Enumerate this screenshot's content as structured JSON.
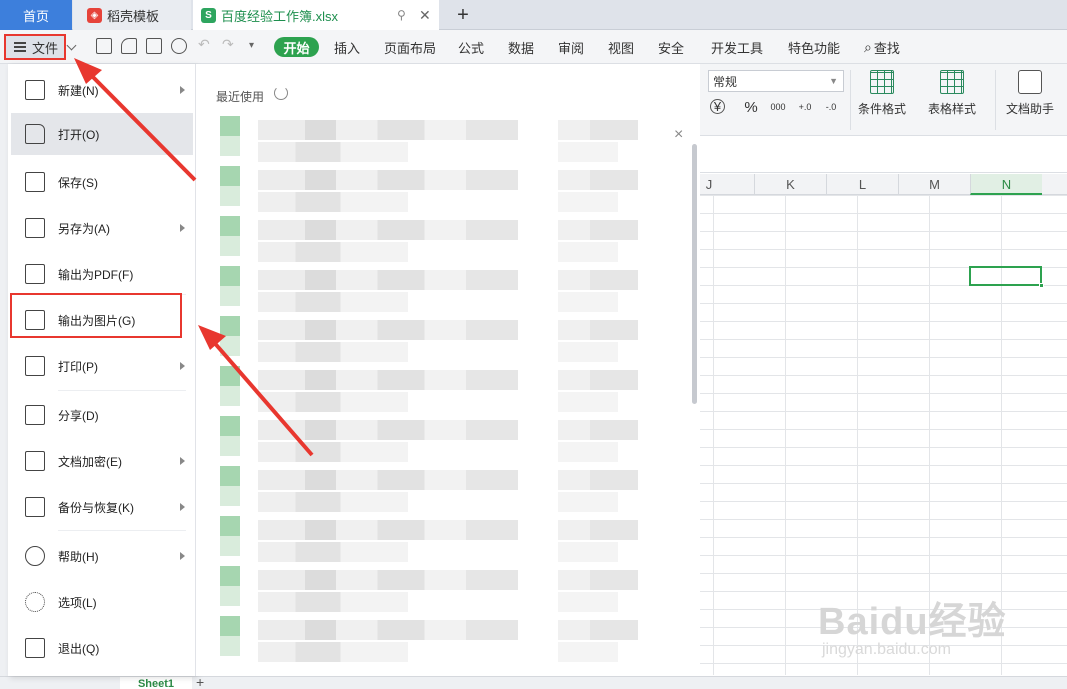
{
  "tabs": {
    "home": "首页",
    "templates": "稻壳模板",
    "workbook": "百度经验工作簿.xlsx",
    "new_tab": "+"
  },
  "menubar": {
    "file": "文件",
    "items": [
      "开始",
      "插入",
      "页面布局",
      "公式",
      "数据",
      "审阅",
      "视图",
      "安全",
      "开发工具",
      "特色功能",
      "查找"
    ]
  },
  "ribbon": {
    "number_format": "常规",
    "currency_symbol": "¥",
    "percent": "%",
    "thousands": "000",
    "inc_decimal": "+.0",
    "dec_decimal": "-.0",
    "conditional_format": "条件格式",
    "table_style": "表格样式",
    "doc_assistant": "文档助手"
  },
  "grid": {
    "columns": [
      "J",
      "K",
      "L",
      "M",
      "N"
    ],
    "active_column": "N"
  },
  "file_menu": {
    "items": [
      {
        "label": "新建(N)",
        "icon": "new-file-icon",
        "submenu": true
      },
      {
        "label": "打开(O)",
        "icon": "folder-open-icon",
        "submenu": false,
        "hover": true
      },
      {
        "label": "保存(S)",
        "icon": "save-icon",
        "submenu": false
      },
      {
        "label": "另存为(A)",
        "icon": "save-as-icon",
        "submenu": true
      },
      {
        "label": "输出为PDF(F)",
        "icon": "export-pdf-icon",
        "submenu": false
      },
      {
        "label": "输出为图片(G)",
        "icon": "export-image-icon",
        "submenu": false,
        "highlighted": true
      },
      {
        "label": "打印(P)",
        "icon": "print-icon",
        "submenu": true
      },
      {
        "label": "分享(D)",
        "icon": "share-icon",
        "submenu": false
      },
      {
        "label": "文档加密(E)",
        "icon": "encrypt-icon",
        "submenu": true
      },
      {
        "label": "备份与恢复(K)",
        "icon": "backup-icon",
        "submenu": true
      },
      {
        "label": "帮助(H)",
        "icon": "help-icon",
        "submenu": true
      },
      {
        "label": "选项(L)",
        "icon": "settings-icon",
        "submenu": false
      },
      {
        "label": "退出(Q)",
        "icon": "exit-icon",
        "submenu": false
      }
    ]
  },
  "recent": {
    "title": "最近使用",
    "close": "×"
  },
  "sheets": {
    "active": "Sheet1",
    "add": "+"
  },
  "watermark": {
    "logo": "Baidu经验",
    "url": "jingyan.baidu.com"
  },
  "colors": {
    "accent_green": "#2da24f",
    "annotation_red": "#e8372f",
    "home_tab_blue": "#3d7fdc"
  }
}
